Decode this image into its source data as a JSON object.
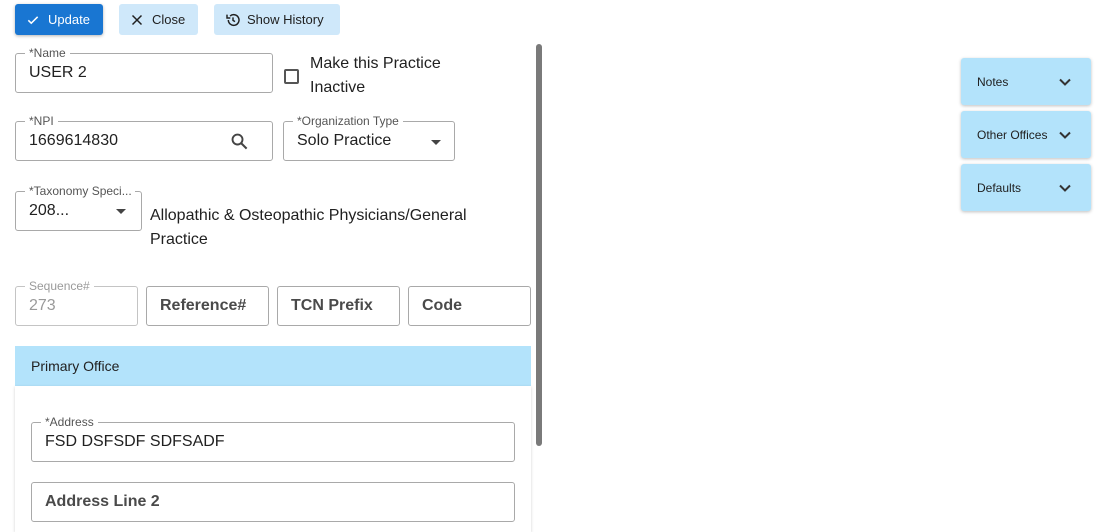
{
  "toolbar": {
    "update_label": "Update",
    "close_label": "Close",
    "history_label": "Show History"
  },
  "form": {
    "name": {
      "label": "*Name",
      "value": "USER 2"
    },
    "inactive_checkbox": {
      "label": "Make this Practice Inactive",
      "checked": false
    },
    "npi": {
      "label": "*NPI",
      "value": "1669614830"
    },
    "org_type": {
      "label": "*Organization Type",
      "value": "Solo Practice"
    },
    "taxonomy": {
      "label": "*Taxonomy Speci...",
      "value": "208...",
      "description": "Allopathic & Osteopathic Physicians/General Practice"
    },
    "sequence": {
      "label": "Sequence#",
      "value": "273"
    },
    "reference": {
      "placeholder": "Reference#"
    },
    "tcn_prefix": {
      "placeholder": "TCN Prefix"
    },
    "code": {
      "placeholder": "Code"
    }
  },
  "primary_office": {
    "title": "Primary Office",
    "address": {
      "label": "*Address",
      "value": "FSD DSFSDF SDFSADF"
    },
    "address_line2": {
      "placeholder": "Address Line 2"
    }
  },
  "side_panels": [
    {
      "label": "Notes"
    },
    {
      "label": "Other Offices"
    },
    {
      "label": "Defaults"
    }
  ],
  "colors": {
    "primary": "#1976d2",
    "secondary_button": "#cfe8fa",
    "panel_header": "#b3e3fb"
  },
  "icons": [
    "check-icon",
    "close-icon",
    "history-icon",
    "search-icon",
    "dropdown-caret-icon",
    "chevron-down-icon"
  ]
}
